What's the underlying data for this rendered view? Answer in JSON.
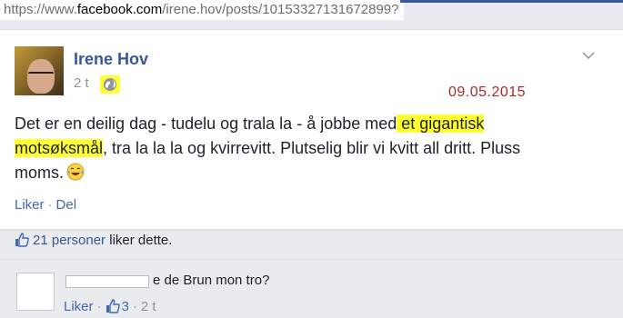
{
  "browser": {
    "url_prefix": "https://www.",
    "url_domain": "facebook.com",
    "url_path": "/irene.hov/posts/10153327131672899?"
  },
  "post": {
    "author": "Irene Hov",
    "time_ago": "2 t",
    "privacy_icon": "globe-icon",
    "date_annotation": "09.05.2015",
    "text_part1": "Det er en deilig dag - tudelu og trala la - å jobbe med",
    "text_highlight": " et gigantisk motsøksmål",
    "text_part2": ", tra la la la og kvirrevitt. Plutselig blir vi kvitt all dritt. Pluss moms.",
    "emoji": "laughing-emoji",
    "actions": {
      "like": "Liker",
      "separator": "·",
      "share": "Del"
    },
    "highlight_color": "#ffff33"
  },
  "likes": {
    "icon": "thumbs-up-icon",
    "link": "21 personer",
    "suffix": " liker dette."
  },
  "comment": {
    "text": "e de Brun mon tro?",
    "actions": {
      "like": "Liker",
      "separator": "·",
      "like_count": "3",
      "time_ago": "2 t"
    }
  },
  "colors": {
    "link_blue": "#365899",
    "date_red": "#a52a2a",
    "meta_gray": "#90949c"
  }
}
